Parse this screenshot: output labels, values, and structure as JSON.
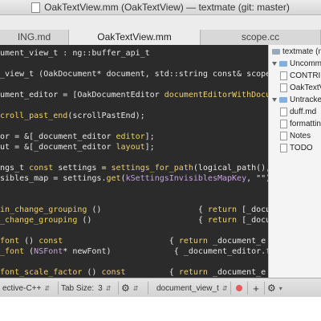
{
  "window": {
    "title": "OakTextView.mm (OakTextView) — textmate (git: master)"
  },
  "tabs": [
    {
      "label": "ING.md",
      "active": false
    },
    {
      "label": "OakTextView.mm",
      "active": true
    },
    {
      "label": "scope.cc",
      "active": false
    }
  ],
  "code_lines": [
    {
      "segments": [
        {
          "t": "cument_view_t : ng::buffer_api_t",
          "c": "c-ws"
        }
      ]
    },
    {
      "segments": [
        {
          "t": "",
          "c": "c-ws"
        }
      ]
    },
    {
      "segments": [
        {
          "t": "t_view_t (OakDocument* document, std::string const& scopeAt",
          "c": "c-ws"
        }
      ]
    },
    {
      "segments": [
        {
          "t": "",
          "c": "c-ws"
        }
      ]
    },
    {
      "segments": [
        {
          "t": "cument_editor = [OakDocumentEditor ",
          "c": "c-ws"
        },
        {
          "t": "documentEditorWithDocumen",
          "c": "c-fn"
        }
      ]
    },
    {
      "segments": [
        {
          "t": "",
          "c": "c-ws"
        }
      ]
    },
    {
      "segments": [
        {
          "t": "scroll_past_end",
          "c": "c-fn"
        },
        {
          "t": "(scrollPastEnd);",
          "c": "c-ws"
        }
      ]
    },
    {
      "segments": [
        {
          "t": "",
          "c": "c-ws"
        }
      ]
    },
    {
      "segments": [
        {
          "t": "tor = &[_document_editor ",
          "c": "c-ws"
        },
        {
          "t": "editor",
          "c": "c-fn"
        },
        {
          "t": "];",
          "c": "c-ws"
        }
      ]
    },
    {
      "segments": [
        {
          "t": "out = &[_document_editor ",
          "c": "c-ws"
        },
        {
          "t": "layout",
          "c": "c-fn"
        },
        {
          "t": "];",
          "c": "c-ws"
        }
      ]
    },
    {
      "segments": [
        {
          "t": "",
          "c": "c-ws"
        }
      ]
    },
    {
      "segments": [
        {
          "t": "ings_t ",
          "c": "c-ws"
        },
        {
          "t": "const",
          "c": "c-kw"
        },
        {
          "t": " settings = ",
          "c": "c-ws"
        },
        {
          "t": "settings_for_path",
          "c": "c-fn"
        },
        {
          "t": "(logical_path(), f",
          "c": "c-ws"
        }
      ]
    },
    {
      "segments": [
        {
          "t": "isibles_map = settings.",
          "c": "c-ws"
        },
        {
          "t": "get",
          "c": "c-fn"
        },
        {
          "t": "(",
          "c": "c-ws"
        },
        {
          "t": "kSettingsInvisiblesMapKey",
          "c": "c-id"
        },
        {
          "t": ", \"\");",
          "c": "c-ws"
        }
      ]
    },
    {
      "segments": [
        {
          "t": "",
          "c": "c-ws"
        }
      ]
    },
    {
      "segments": [
        {
          "t": "",
          "c": "c-ws"
        }
      ]
    },
    {
      "segments": [
        {
          "t": "gin_change_grouping",
          "c": "c-fn"
        },
        {
          "t": " ()                    { ",
          "c": "c-ws"
        },
        {
          "t": "return",
          "c": "c-kw"
        },
        {
          "t": " [_document_",
          "c": "c-ws"
        }
      ]
    },
    {
      "segments": [
        {
          "t": "d_change_grouping",
          "c": "c-fn"
        },
        {
          "t": " ()                      { ",
          "c": "c-ws"
        },
        {
          "t": "return",
          "c": "c-kw"
        },
        {
          "t": " [_document_",
          "c": "c-ws"
        }
      ]
    },
    {
      "segments": [
        {
          "t": "",
          "c": "c-ws"
        }
      ]
    },
    {
      "segments": [
        {
          "t": " font",
          "c": "c-fn"
        },
        {
          "t": " () ",
          "c": "c-ws"
        },
        {
          "t": "const",
          "c": "c-kw"
        },
        {
          "t": "                      { ",
          "c": "c-ws"
        },
        {
          "t": "return",
          "c": "c-kw"
        },
        {
          "t": " _document_e",
          "c": "c-ws"
        }
      ]
    },
    {
      "segments": [
        {
          "t": "t_font",
          "c": "c-fn"
        },
        {
          "t": " (",
          "c": "c-ws"
        },
        {
          "t": "NSFont",
          "c": "c-id"
        },
        {
          "t": "* newFont)             { _document_editor.f",
          "c": "c-ws"
        }
      ]
    },
    {
      "segments": [
        {
          "t": "",
          "c": "c-ws"
        }
      ]
    },
    {
      "segments": [
        {
          "t": " font_scale_factor",
          "c": "c-fn"
        },
        {
          "t": " () ",
          "c": "c-ws"
        },
        {
          "t": "const",
          "c": "c-kw"
        },
        {
          "t": "         { ",
          "c": "c-ws"
        },
        {
          "t": "return",
          "c": "c-kw"
        },
        {
          "t": " _document_e",
          "c": "c-ws"
        }
      ]
    }
  ],
  "drawer": {
    "items": [
      {
        "label": "textmate (ma",
        "kind": "root"
      },
      {
        "label": "Uncommitted",
        "kind": "group"
      },
      {
        "label": "CONTRIBUTING.md",
        "kind": "file"
      },
      {
        "label": "OakTextView.mm",
        "kind": "file"
      },
      {
        "label": "Untracked",
        "kind": "group"
      },
      {
        "label": "duff.md",
        "kind": "file"
      },
      {
        "label": "formatting",
        "kind": "file"
      },
      {
        "label": "Notes",
        "kind": "file"
      },
      {
        "label": "TODO",
        "kind": "file"
      }
    ]
  },
  "status": {
    "grammar": "ective-C++",
    "tab_size_label": "Tab Size:",
    "tab_size_value": "3",
    "symbol": "document_view_t"
  },
  "colors": {
    "editor_bg": "#2b2b2b",
    "record_dot": "#e85a5a"
  }
}
